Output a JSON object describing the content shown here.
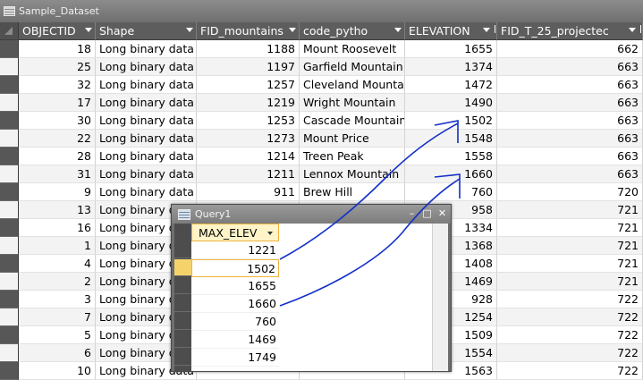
{
  "window": {
    "title": "Sample_Dataset"
  },
  "table": {
    "columns": [
      {
        "label": "OBJECTID",
        "sorted": false
      },
      {
        "label": "Shape",
        "sorted": false
      },
      {
        "label": "FID_mountains",
        "sorted": false
      },
      {
        "label": "code_pytho",
        "sorted": false
      },
      {
        "label": "ELEVATION",
        "sorted": true
      },
      {
        "label": "FID_T_25_projectec",
        "sorted": true
      }
    ],
    "rows": [
      {
        "oid": "18",
        "shape": "Long binary data",
        "fid": "1188",
        "code": "Mount Roosevelt",
        "elev": "1655",
        "proj": "662"
      },
      {
        "oid": "25",
        "shape": "Long binary data",
        "fid": "1197",
        "code": "Garfield Mountain",
        "elev": "1374",
        "proj": "663"
      },
      {
        "oid": "32",
        "shape": "Long binary data",
        "fid": "1257",
        "code": "Cleveland Mountain",
        "elev": "1472",
        "proj": "663"
      },
      {
        "oid": "17",
        "shape": "Long binary data",
        "fid": "1219",
        "code": "Wright Mountain",
        "elev": "1490",
        "proj": "663"
      },
      {
        "oid": "30",
        "shape": "Long binary data",
        "fid": "1253",
        "code": "Cascade Mountain",
        "elev": "1502",
        "proj": "663"
      },
      {
        "oid": "22",
        "shape": "Long binary data",
        "fid": "1273",
        "code": "Mount Price",
        "elev": "1548",
        "proj": "663"
      },
      {
        "oid": "28",
        "shape": "Long binary data",
        "fid": "1214",
        "code": "Treen Peak",
        "elev": "1558",
        "proj": "663"
      },
      {
        "oid": "31",
        "shape": "Long binary data",
        "fid": "1211",
        "code": "Lennox Mountain",
        "elev": "1660",
        "proj": "663"
      },
      {
        "oid": "9",
        "shape": "Long binary data",
        "fid": "911",
        "code": "Brew Hill",
        "elev": "760",
        "proj": "720"
      },
      {
        "oid": "13",
        "shape": "Long binary data",
        "fid": "",
        "code": "",
        "elev": "958",
        "proj": "721"
      },
      {
        "oid": "16",
        "shape": "Long binary data",
        "fid": "",
        "code": "",
        "elev": "1334",
        "proj": "721"
      },
      {
        "oid": "1",
        "shape": "Long binary data",
        "fid": "",
        "code": "",
        "elev": "1368",
        "proj": "721"
      },
      {
        "oid": "4",
        "shape": "Long binary data",
        "fid": "",
        "code": "",
        "elev": "1408",
        "proj": "721"
      },
      {
        "oid": "2",
        "shape": "Long binary data",
        "fid": "",
        "code": "",
        "elev": "1469",
        "proj": "721"
      },
      {
        "oid": "3",
        "shape": "Long binary data",
        "fid": "",
        "code": "",
        "elev": "928",
        "proj": "722"
      },
      {
        "oid": "7",
        "shape": "Long binary data",
        "fid": "",
        "code": "",
        "elev": "1254",
        "proj": "722"
      },
      {
        "oid": "5",
        "shape": "Long binary data",
        "fid": "",
        "code": "",
        "elev": "1509",
        "proj": "722"
      },
      {
        "oid": "6",
        "shape": "Long binary data",
        "fid": "",
        "code": "",
        "elev": "1554",
        "proj": "722"
      },
      {
        "oid": "10",
        "shape": "Long binary data",
        "fid": "",
        "code": "",
        "elev": "1563",
        "proj": "722"
      }
    ]
  },
  "query": {
    "title": "Query1",
    "buttons": {
      "minimize": "–",
      "restore": "□",
      "close": "✕"
    },
    "column": "MAX_ELEV",
    "values": [
      "1221",
      "1502",
      "1655",
      "1660",
      "760",
      "1469",
      "1749"
    ],
    "selected_index": 1
  },
  "annotation": {
    "color": "#1430c8"
  },
  "icons": {
    "window": "table-icon",
    "query": "query-icon",
    "header_dropdown": "dropdown-arrow-icon",
    "sort": "sort-indicator-icon"
  }
}
